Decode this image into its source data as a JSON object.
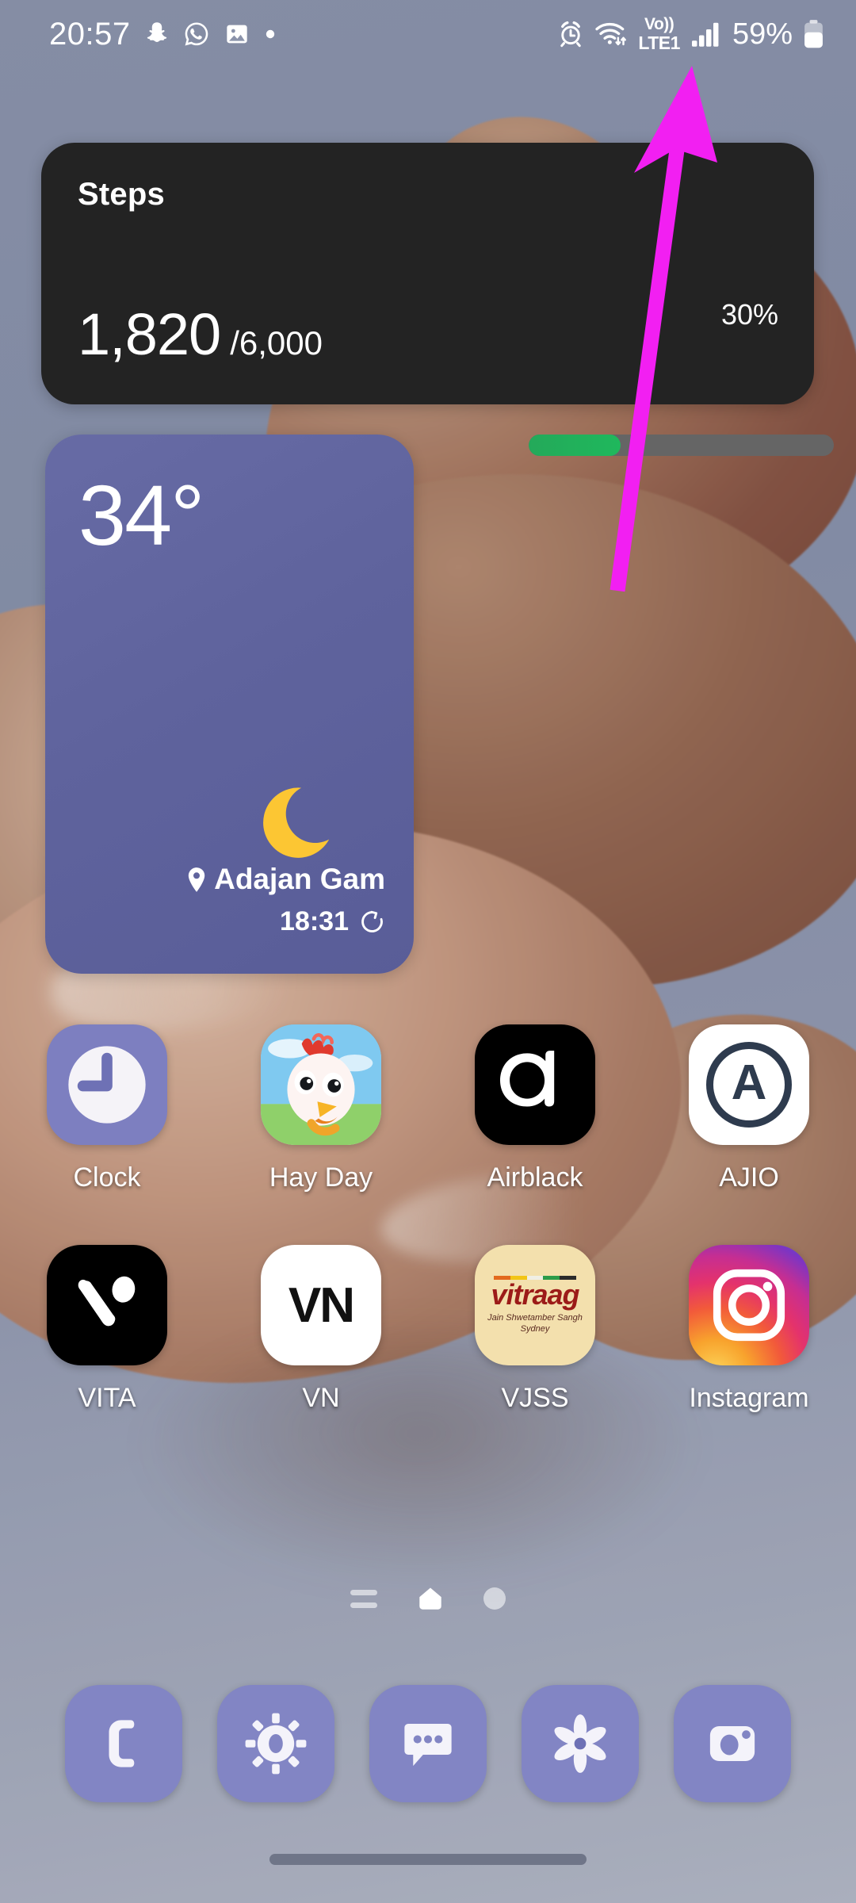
{
  "status_bar": {
    "time": "20:57",
    "left_icons": [
      "snapchat-icon",
      "whatsapp-icon",
      "gallery-icon",
      "dot-icon"
    ],
    "right_icons": [
      "alarm-icon",
      "wifi-icon",
      "volte-icon",
      "signal-icon",
      "battery-icon"
    ],
    "volte_label_top": "Vo))",
    "volte_label_bottom": "LTE1",
    "battery_percent": "59%"
  },
  "steps_widget": {
    "title": "Steps",
    "count": "1,820",
    "goal": "/6,000",
    "percent_label": "30%",
    "progress_value": 30,
    "fill_color": "#21b45a",
    "track_color": "#656565",
    "background": "#232323"
  },
  "weather_widget": {
    "temperature": "34°",
    "condition_icon": "crescent-moon-icon",
    "location": "Adajan Gam",
    "location_icon": "location-pin-icon",
    "updated_time": "18:31",
    "refresh_icon": "refresh-icon",
    "background": "#5f639d"
  },
  "app_grid": {
    "rows": [
      [
        {
          "label": "Clock",
          "icon": "clock-app-icon"
        },
        {
          "label": "Hay Day",
          "icon": "hayday-app-icon"
        },
        {
          "label": "Airblack",
          "icon": "airblack-app-icon"
        },
        {
          "label": "AJIO",
          "icon": "ajio-app-icon"
        }
      ],
      [
        {
          "label": "VITA",
          "icon": "vita-app-icon"
        },
        {
          "label": "VN",
          "icon": "vn-app-icon"
        },
        {
          "label": "VJSS",
          "icon": "vjss-app-icon"
        },
        {
          "label": "Instagram",
          "icon": "instagram-app-icon"
        }
      ]
    ],
    "vn_glyph": "VN",
    "ajio_glyph": "A",
    "vjss": {
      "main": "vitraag",
      "sub1": "Jain Shwetamber Sangh",
      "sub2": "Sydney"
    }
  },
  "page_indicator": {
    "items": [
      "app-list-indicator",
      "home-page-indicator",
      "page-dot-indicator"
    ],
    "current": "home-page-indicator"
  },
  "dock": {
    "items": [
      {
        "name": "phone",
        "icon": "phone-icon"
      },
      {
        "name": "settings",
        "icon": "gear-icon"
      },
      {
        "name": "messages",
        "icon": "message-bubble-icon"
      },
      {
        "name": "gallery",
        "icon": "flower-icon"
      },
      {
        "name": "camera",
        "icon": "camera-icon"
      }
    ],
    "background": "#8285c4"
  },
  "navigation": {
    "gesture_pill": "gesture-navigation-pill"
  },
  "annotation": {
    "type": "arrow",
    "color": "#f21ff2",
    "points_to": "signal-bars-icon"
  }
}
